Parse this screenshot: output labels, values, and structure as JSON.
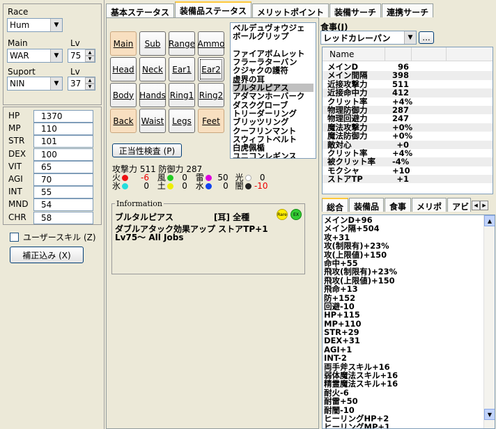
{
  "left": {
    "race_label": "Race",
    "race_value": "Hum",
    "main_label": "Main",
    "main_value": "WAR",
    "main_lv_label": "Lv",
    "main_lv": "75",
    "support_label": "Suport",
    "support_value": "NIN",
    "support_lv_label": "Lv",
    "support_lv": "37",
    "stats": [
      {
        "name": "HP",
        "value": "1370"
      },
      {
        "name": "MP",
        "value": "110"
      },
      {
        "name": "STR",
        "value": "101"
      },
      {
        "name": "DEX",
        "value": "100"
      },
      {
        "name": "VIT",
        "value": "65"
      },
      {
        "name": "AGI",
        "value": "70"
      },
      {
        "name": "INT",
        "value": "55"
      },
      {
        "name": "MND",
        "value": "54"
      },
      {
        "name": "CHR",
        "value": "58"
      }
    ],
    "user_skill_label": "ユーザースキル (Z)",
    "correction_label": "補正込み (X)"
  },
  "tabs": [
    "基本ステータス",
    "装備品ステータス",
    "メリットポイント",
    "装備サーチ",
    "連携サーチ"
  ],
  "slots": [
    "Main",
    "Sub",
    "Range",
    "Ammo",
    "Head",
    "Neck",
    "Ear1",
    "Ear2",
    "Body",
    "Hands",
    "Ring1",
    "Ring2",
    "Back",
    "Waist",
    "Legs",
    "Feet"
  ],
  "validity_button": "正当性検査 (P)",
  "attack_line": "攻撃力 511 防御力 287",
  "elements": {
    "fire_label": "火",
    "fire_value": "-6",
    "wind_label": "風",
    "wind_value": "0",
    "thunder_label": "雷",
    "thunder_value": "50",
    "light_label": "光",
    "light_value": "0",
    "ice_label": "氷",
    "ice_value": "0",
    "earth_label": "土",
    "earth_value": "0",
    "water_label": "水",
    "water_value": "0",
    "dark_label": "闇",
    "dark_value": "-10"
  },
  "colors": {
    "fire": "#ee1111",
    "wind": "#22cc22",
    "thunder": "#dd00dd",
    "light": "#ffffff",
    "ice": "#22dddd",
    "earth": "#eeee00",
    "water": "#1144ee",
    "dark": "#222222",
    "negative": "#ee0000"
  },
  "equip_list": [
    "ベルデュヴォウジェ",
    "ボールグリップ",
    "",
    "ファイアボムレット",
    "フラーラターバン",
    "クジャクの護符",
    "虚界の耳",
    "ブルタルピアス",
    "アダマンホーバーク",
    "ダスクグローブ",
    "トリーダーリング",
    "ブリッツリング",
    "クーフリンマント",
    "スウィフトベルト",
    "白虎佩楯",
    "ユニコンレギンス"
  ],
  "info": {
    "legend": "Information",
    "item_name": "ブルタルピアス",
    "slot_tag": "[耳] 全種",
    "badge_rare": "Rare",
    "badge_ex": "EX",
    "desc": "ダブルアタック効果アップ ストアTP+1",
    "jobs": "Lv75～ All Jobs"
  },
  "food": {
    "label": "食事(J)",
    "value": "レッドカレーパン",
    "more_button": "..."
  },
  "stat_table": {
    "header": "Name",
    "rows": [
      {
        "name": "メインD",
        "value": "96"
      },
      {
        "name": "メイン間隔",
        "value": "398"
      },
      {
        "name": "近接攻撃力",
        "value": "511"
      },
      {
        "name": "近接命中力",
        "value": "412"
      },
      {
        "name": "クリット率",
        "value": "+4%"
      },
      {
        "name": "物理防御力",
        "value": "287"
      },
      {
        "name": "物理回避力",
        "value": "247"
      },
      {
        "name": "魔法攻撃力",
        "value": "+0%"
      },
      {
        "name": "魔法防御力",
        "value": "+0%"
      },
      {
        "name": "敵対心",
        "value": "+0"
      },
      {
        "name": "クリット率",
        "value": "+4%"
      },
      {
        "name": "被クリット率",
        "value": "-4%"
      },
      {
        "name": "モクシャ",
        "value": "+10"
      },
      {
        "name": "ストアTP",
        "value": "+1"
      }
    ]
  },
  "right_tabs": [
    "総合",
    "装備品",
    "食事",
    "メリポ",
    "アビ"
  ],
  "summary_lines": [
    "メインD+96",
    "メイン隔+504",
    "攻+31",
    "攻(制限有)+23%",
    "攻(上限値)+150",
    "命中+55",
    "飛攻(制限有)+23%",
    "飛攻(上限値)+150",
    "飛命+13",
    "防+152",
    "回避-10",
    "HP+115",
    "MP+110",
    "STR+29",
    "DEX+31",
    "AGI+1",
    "INT-2",
    "両手斧スキル+16",
    "弱体魔法スキル+16",
    "精霊魔法スキル+16",
    "耐火-6",
    "耐雷+50",
    "耐闇-10",
    "ヒーリングHP+2",
    "ヒーリングMP+1"
  ]
}
